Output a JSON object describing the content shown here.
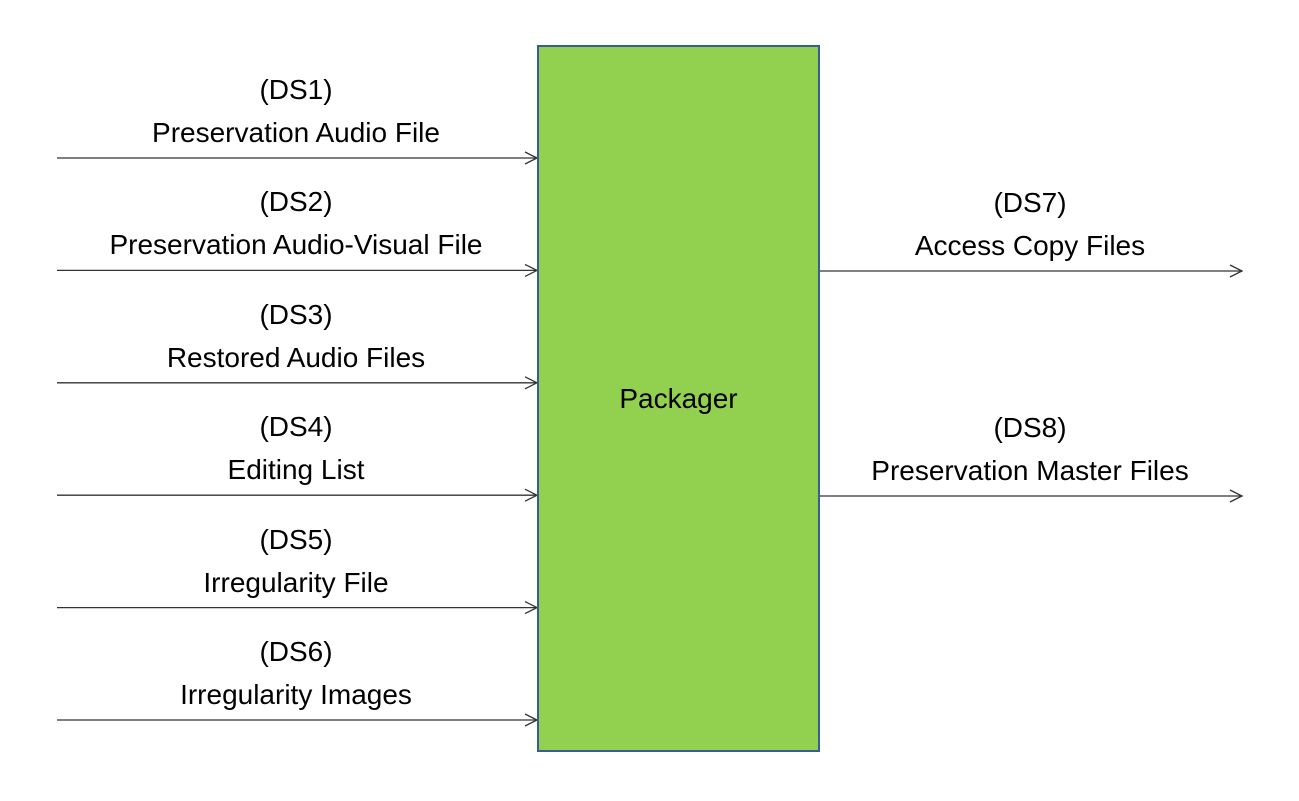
{
  "process": {
    "label": "Packager",
    "fill": "#92D050",
    "border": "#3A5A9A"
  },
  "inputs": [
    {
      "id": "(DS1)",
      "name": "Preservation Audio File"
    },
    {
      "id": "(DS2)",
      "name": "Preservation Audio-Visual File"
    },
    {
      "id": "(DS3)",
      "name": "Restored Audio Files"
    },
    {
      "id": "(DS4)",
      "name": "Editing List"
    },
    {
      "id": "(DS5)",
      "name": "Irregularity File"
    },
    {
      "id": "(DS6)",
      "name": "Irregularity Images"
    }
  ],
  "outputs": [
    {
      "id": "(DS7)",
      "name": "Access Copy Files"
    },
    {
      "id": "(DS8)",
      "name": "Preservation Master Files"
    }
  ]
}
